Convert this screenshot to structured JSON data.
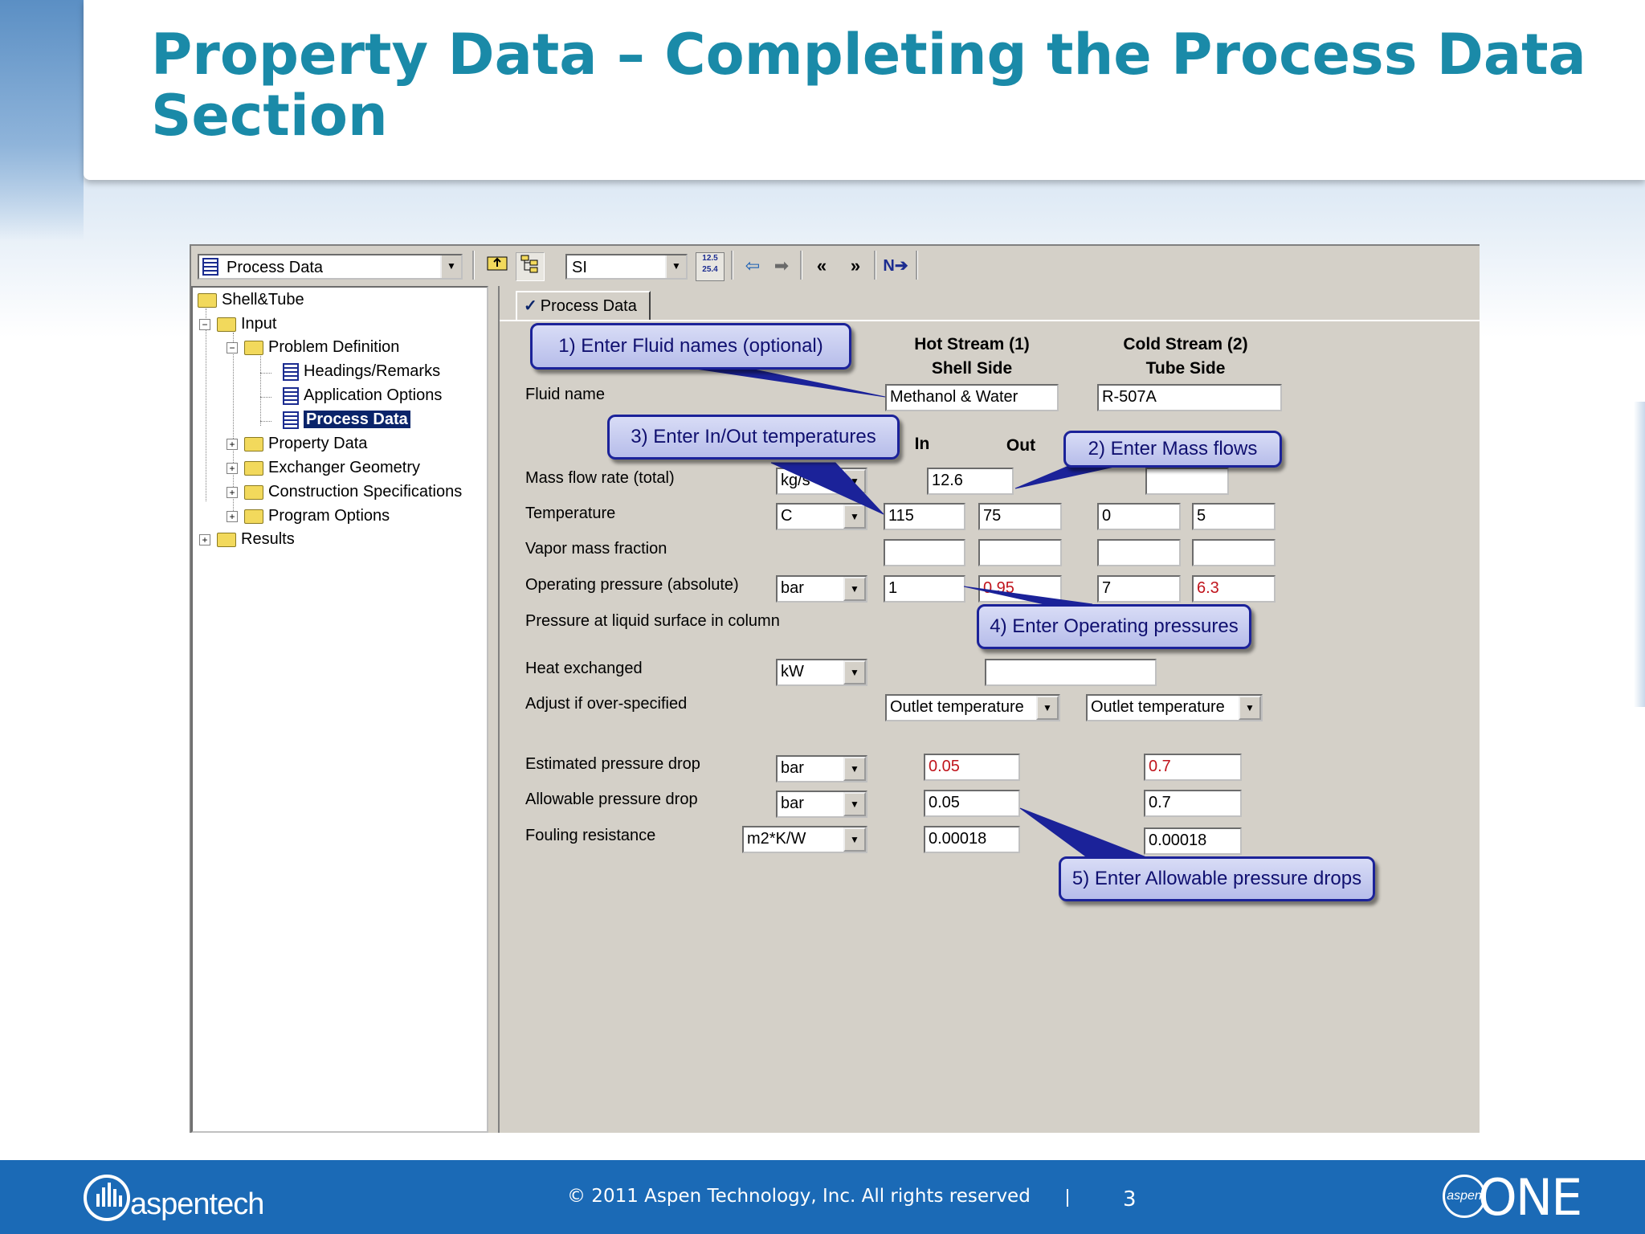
{
  "slide": {
    "title": "Property Data – Completing the Process Data Section",
    "page_number": "3",
    "copyright": "© 2011 Aspen Technology, Inc. All rights reserved",
    "separator": "|",
    "logo_left": "aspentech",
    "logo_right": "ONE",
    "logo_right_badge": "aspen"
  },
  "toolbar": {
    "form_select": "Process Data",
    "units_select": "SI",
    "units_icon_text": "12.5 25.4",
    "buttons": [
      "folder-up",
      "tree-toggle",
      "units-convert",
      "back",
      "forward",
      "previous",
      "next",
      "next-required"
    ]
  },
  "tree": {
    "root": "Shell&Tube",
    "input": "Input",
    "problem_definition": "Problem Definition",
    "headings": "Headings/Remarks",
    "application_options": "Application Options",
    "process_data": "Process Data",
    "property_data": "Property Data",
    "exchanger_geometry": "Exchanger Geometry",
    "construction": "Construction Specifications",
    "program_options": "Program Options",
    "results": "Results"
  },
  "tab": {
    "label": "Process Data"
  },
  "headers": {
    "hot_line1": "Hot Stream (1)",
    "hot_line2": "Shell Side",
    "cold_line1": "Cold Stream (2)",
    "cold_line2": "Tube Side",
    "in": "In",
    "out": "Out"
  },
  "rows": {
    "fluid_name": "Fluid name",
    "mass_flow": "Mass flow rate (total)",
    "temperature": "Temperature",
    "vapor_fraction": "Vapor mass fraction",
    "operating_pressure": "Operating pressure (absolute)",
    "liquid_surface": "Pressure at liquid surface in column",
    "heat_exchanged": "Heat exchanged",
    "adjust": "Adjust if over-specified",
    "est_dp": "Estimated pressure drop",
    "allow_dp": "Allowable pressure drop",
    "fouling": "Fouling resistance"
  },
  "units": {
    "mass_flow": "kg/s",
    "temperature": "C",
    "pressure": "bar",
    "heat": "kW",
    "est_dp": "bar",
    "allow_dp": "bar",
    "fouling": "m2*K/W"
  },
  "values": {
    "hot_fluid": "Methanol & Water",
    "cold_fluid": "R-507A",
    "hot_mass_flow": "12.6",
    "cold_mass_flow": "",
    "hot_temp_in": "115",
    "hot_temp_out": "75",
    "cold_temp_in": "0",
    "cold_temp_out": "5",
    "hot_vap_in": "",
    "hot_vap_out": "",
    "cold_vap_in": "",
    "cold_vap_out": "",
    "hot_press_in": "1",
    "hot_press_out": "0.95",
    "cold_press_in": "7",
    "cold_press_out": "6.3",
    "heat_exchanged": "",
    "hot_adjust": "Outlet temperature",
    "cold_adjust": "Outlet temperature",
    "hot_est_dp": "0.05",
    "cold_est_dp": "0.7",
    "hot_allow_dp": "0.05",
    "cold_allow_dp": "0.7",
    "hot_fouling": "0.00018",
    "cold_fouling": "0.00018"
  },
  "callouts": {
    "c1": "1) Enter Fluid names (optional)",
    "c2": "2) Enter Mass flows",
    "c3": "3) Enter In/Out temperatures",
    "c4": "4) Enter Operating pressures",
    "c5": "5) Enter Allowable pressure drops"
  },
  "colors": {
    "title": "#1a8aa8",
    "footer": "#1b6ab6",
    "callout_border": "#1b2299",
    "computed_value": "#c0141c",
    "window": "#d4d0c8"
  }
}
